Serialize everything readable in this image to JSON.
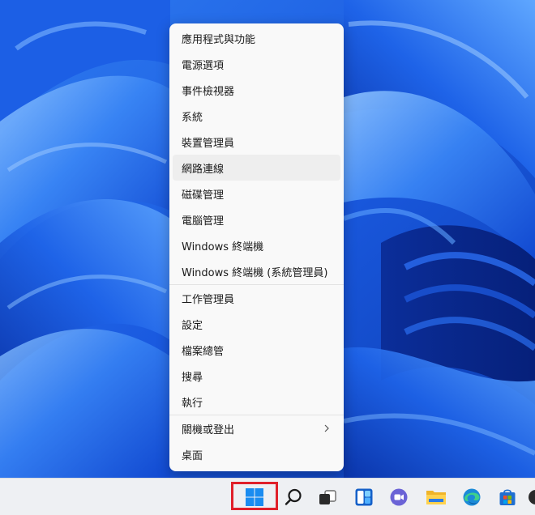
{
  "menu": {
    "items": [
      {
        "label": "應用程式與功能"
      },
      {
        "label": "電源選項"
      },
      {
        "label": "事件檢視器"
      },
      {
        "label": "系統"
      },
      {
        "label": "裝置管理員"
      },
      {
        "label": "網路連線",
        "hovered": true
      },
      {
        "label": "磁碟管理"
      },
      {
        "label": "電腦管理"
      },
      {
        "label": "Windows 終端機"
      },
      {
        "label": "Windows 終端機 (系統管理員)"
      },
      {
        "label": "工作管理員"
      },
      {
        "label": "設定"
      },
      {
        "label": "檔案總管"
      },
      {
        "label": "搜尋"
      },
      {
        "label": "執行"
      },
      {
        "label": "關機或登出",
        "submenu": true
      },
      {
        "label": "桌面"
      }
    ]
  },
  "taskbar": {
    "icons": [
      {
        "name": "windows-start-icon",
        "highlighted": true
      },
      {
        "name": "search-icon"
      },
      {
        "name": "task-view-icon"
      },
      {
        "name": "widgets-icon"
      },
      {
        "name": "chat-icon"
      },
      {
        "name": "file-explorer-icon"
      },
      {
        "name": "edge-icon"
      },
      {
        "name": "store-icon"
      }
    ]
  },
  "colors": {
    "menu_bg": "#f9f9f9",
    "hover_bg": "#eeeeee",
    "highlight_border": "#e0202a",
    "taskbar_bg": "#eef0f3",
    "wallpaper_blue": "#1d5fe0"
  }
}
